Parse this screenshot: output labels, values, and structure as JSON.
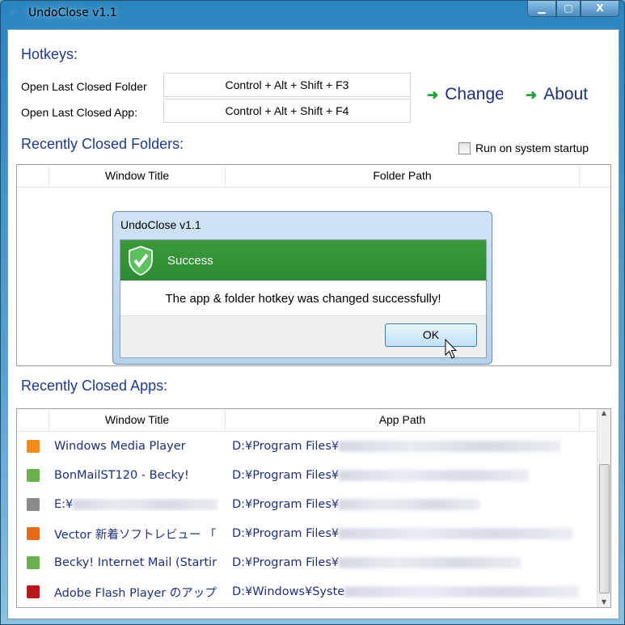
{
  "window": {
    "title": "UndoClose v1.1",
    "minimize": "▁",
    "maximize": "▢",
    "close": "X"
  },
  "hotkeys": {
    "heading": "Hotkeys:",
    "folder_label": "Open Last Closed Folder",
    "folder_value": "Control + Alt + Shift + F3",
    "app_label": "Open Last Closed App:",
    "app_value": "Control + Alt + Shift + F4",
    "change": "Change",
    "about": "About"
  },
  "folders": {
    "heading": "Recently Closed Folders:",
    "startup_label": "Run on system startup",
    "startup_checked": false,
    "columns": [
      "Window Title",
      "Folder Path"
    ]
  },
  "apps": {
    "heading": "Recently Closed Apps:",
    "columns": [
      "Window Title",
      "App Path"
    ],
    "rows": [
      {
        "icon": "media-player-icon",
        "color": "#f08a1c",
        "title": "Windows Media Player",
        "path": "D:¥Program Files¥"
      },
      {
        "icon": "becky-icon",
        "color": "#6ab04c",
        "title": "BonMailST120 - Becky!",
        "path": "D:¥Program Files¥"
      },
      {
        "icon": "notepad-icon",
        "color": "#8a8a8a",
        "title": "E:¥",
        "path": "D:¥Program Files¥"
      },
      {
        "icon": "firefox-icon",
        "color": "#e36b1a",
        "title": "Vector 新着ソフトレビュー 「",
        "path": "D:¥Program Files¥"
      },
      {
        "icon": "becky-icon",
        "color": "#6ab04c",
        "title": "Becky! Internet Mail (Startir",
        "path": "D:¥Program Files¥"
      },
      {
        "icon": "flash-icon",
        "color": "#b8161b",
        "title": "Adobe Flash Player のアップ",
        "path": "D:¥Windows¥Syste"
      }
    ]
  },
  "dialog": {
    "title": "UndoClose v1.1",
    "banner": "Success",
    "message": "The app & folder hotkey was changed successfully!",
    "ok": "OK"
  },
  "colors": {
    "heading": "#1e3a8a",
    "success": "#2e8b34",
    "link_arrow": "#22a33a"
  }
}
